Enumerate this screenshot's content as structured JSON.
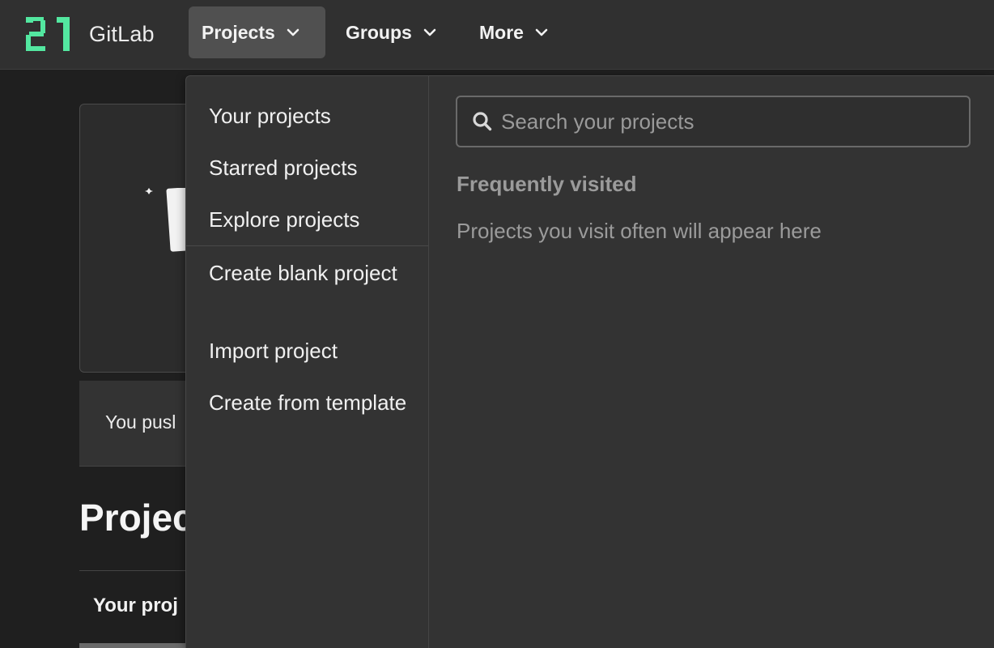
{
  "brand": {
    "name": "GitLab",
    "logo_color": "#53e7a0"
  },
  "nav": {
    "items": [
      {
        "label": "Projects",
        "active": true
      },
      {
        "label": "Groups",
        "active": false
      },
      {
        "label": "More",
        "active": false
      }
    ]
  },
  "background_page": {
    "push_text": "You pusl",
    "title": "Projec",
    "tab": "Your proj"
  },
  "projects_menu": {
    "items": [
      "Your projects",
      "Starred projects",
      "Explore projects",
      "Create blank project",
      "Import project",
      "Create from template"
    ],
    "search": {
      "placeholder": "Search your projects",
      "value": ""
    },
    "frequent": {
      "title": "Frequently visited",
      "empty_text": "Projects you visit often will appear here"
    }
  },
  "icons": {
    "logo": "gitlab-logo",
    "chevron": "chevron-down-icon",
    "search": "search-icon"
  }
}
